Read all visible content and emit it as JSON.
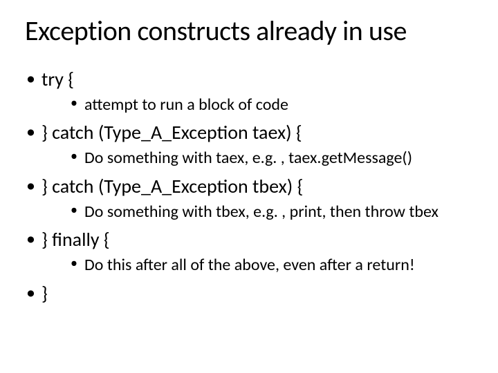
{
  "title": "Exception constructs already in use",
  "bullets": {
    "b0": {
      "text": "try {",
      "sub": "attempt to run a block of code"
    },
    "b1": {
      "text": "} catch (Type_A_Exception taex) {",
      "sub": "Do something with taex, e.g. , taex.getMessage()"
    },
    "b2": {
      "text": "} catch (Type_A_Exception tbex) {",
      "sub": "Do something with tbex, e.g. , print, then throw tbex"
    },
    "b3": {
      "text": "} finally {",
      "sub": "Do this after all of the above, even after a return!"
    },
    "b4": {
      "text": "}"
    }
  }
}
